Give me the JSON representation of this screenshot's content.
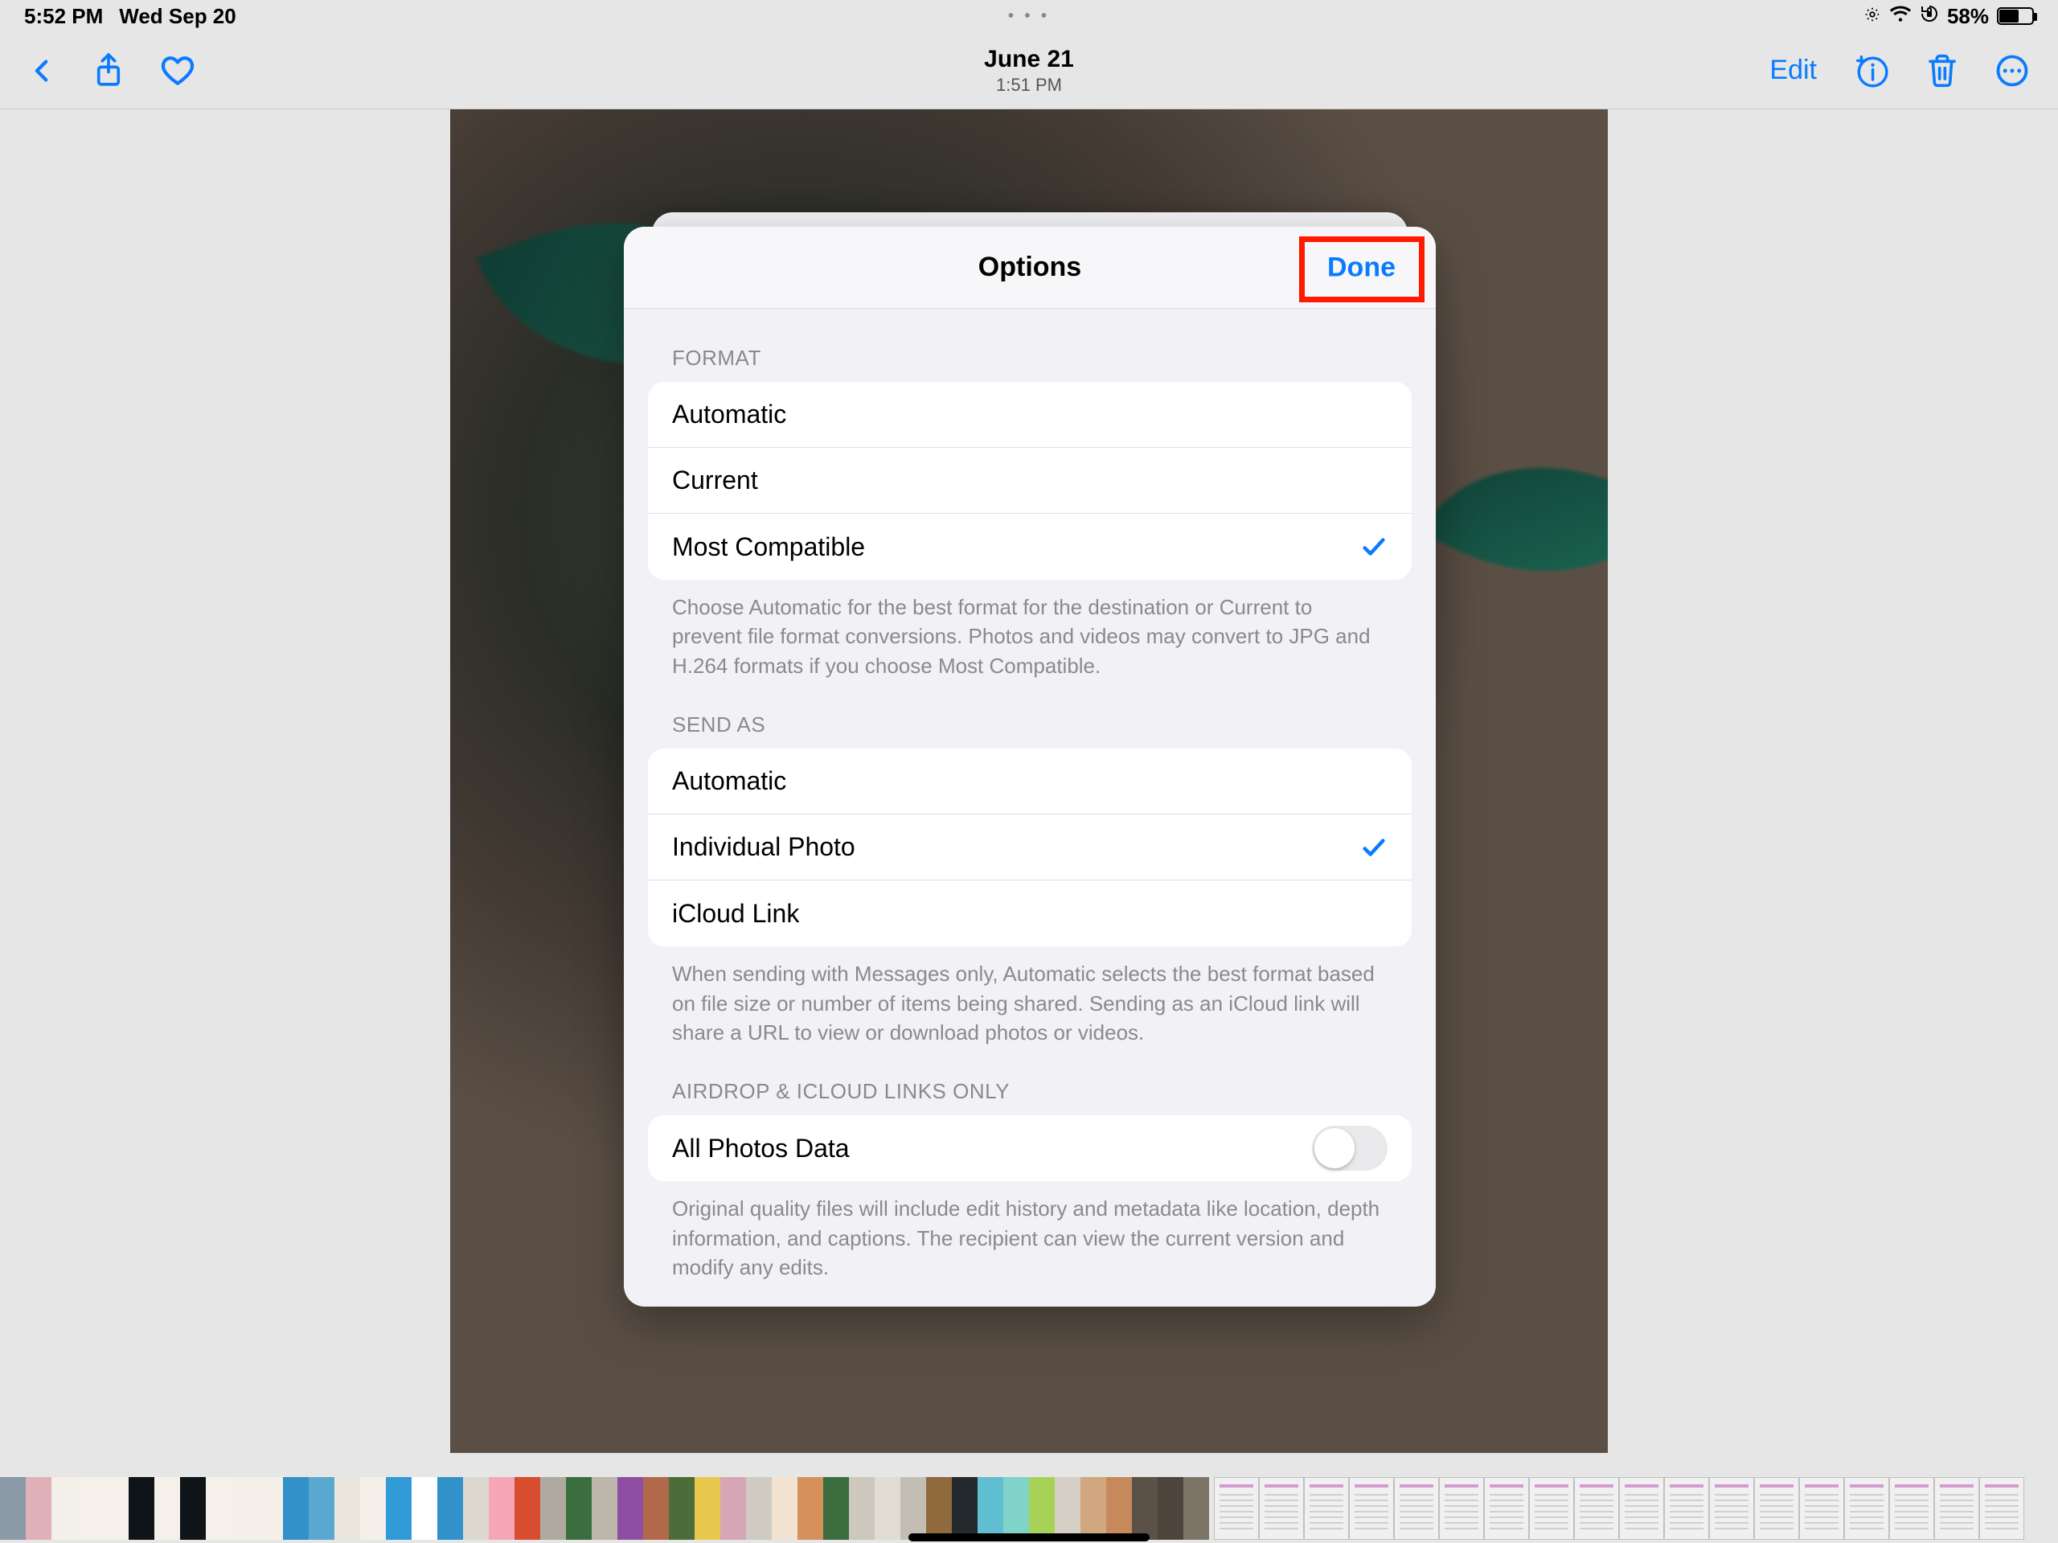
{
  "status": {
    "time": "5:52 PM",
    "date": "Wed Sep 20",
    "battery_pct": "58%",
    "multitask_dots": "• • •"
  },
  "nav": {
    "edit_label": "Edit",
    "photo_date": "June 21",
    "photo_time": "1:51 PM"
  },
  "options": {
    "title": "Options",
    "done_label": "Done",
    "sections": {
      "format": {
        "header": "FORMAT",
        "rows": {
          "automatic": "Automatic",
          "current": "Current",
          "most_compatible": "Most Compatible"
        },
        "footer": "Choose Automatic for the best format for the destination or Current to prevent file format conversions. Photos and videos may convert to JPG and H.264 formats if you choose Most Compatible."
      },
      "send_as": {
        "header": "SEND AS",
        "rows": {
          "automatic": "Automatic",
          "individual_photo": "Individual Photo",
          "icloud_link": "iCloud Link"
        },
        "footer": "When sending with Messages only, Automatic selects the best format based on file size or number of items being shared. Sending as an iCloud link will share a URL to view or download photos or videos."
      },
      "airdrop": {
        "header": "AIRDROP & ICLOUD LINKS ONLY",
        "rows": {
          "all_photos_data": "All Photos Data"
        },
        "footer": "Original quality files will include edit history and metadata like location, depth information, and captions. The recipient can view the current version and modify any edits."
      }
    }
  },
  "thumbs_small": [
    "#8a99a6",
    "#e0b1b8",
    "#f3efe9",
    "#f5f1ea",
    "#f5f1ea",
    "#0f1418",
    "#f5f1ea",
    "#0f1418",
    "#f5f1ea",
    "#f4efe8",
    "#f4efe8",
    "#3291c8",
    "#5aa7cf",
    "#ebe7df",
    "#f4efe8",
    "#309bd6",
    "#ffffff",
    "#3291c8",
    "#dcd8cf",
    "#f6a7b7",
    "#d64d2f",
    "#afaaa0",
    "#3a6e3e",
    "#bcb6ab",
    "#8e4ea3",
    "#b1694a",
    "#4c6d3a",
    "#e8c74d",
    "#d6a6b5",
    "#d0cbc2",
    "#f1e2d2",
    "#d6905a",
    "#3b6d3e",
    "#cdc7bd",
    "#e1dcd3",
    "#c3beb4",
    "#8f6a3c",
    "#252a2e",
    "#5fbecf",
    "#7fd3c8",
    "#a7d257",
    "#d6cfc6",
    "#d0a77e",
    "#c6895c",
    "#5b5147",
    "#4d453b",
    "#7c7467"
  ],
  "highlight": {
    "target": "done-button"
  }
}
